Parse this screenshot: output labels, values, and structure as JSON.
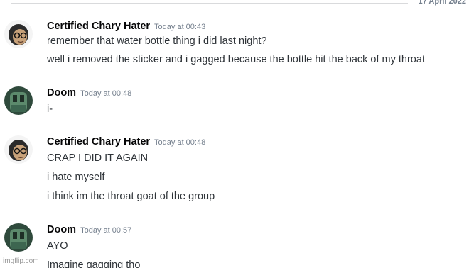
{
  "date_divider": "17 April 2022",
  "groups": [
    {
      "username": "Certified Chary Hater",
      "timestamp": "Today at 00:43",
      "avatar": "glasses-face-avatar",
      "messages": [
        "remember that water bottle thing i did last night?",
        "well i removed the sticker and i gagged because the bottle hit the back of my throat"
      ]
    },
    {
      "username": "Doom",
      "timestamp": "Today at 00:48",
      "avatar": "green-figure-avatar",
      "messages": [
        "i-"
      ]
    },
    {
      "username": "Certified Chary Hater",
      "timestamp": "Today at 00:48",
      "avatar": "glasses-face-avatar",
      "messages": [
        "CRAP I DID IT AGAIN",
        "i hate myself",
        "i think im the throat goat of the group"
      ]
    },
    {
      "username": "Doom",
      "timestamp": "Today at 00:57",
      "avatar": "green-figure-avatar",
      "messages": [
        "AYO",
        "Imagine gagging tho"
      ]
    }
  ],
  "watermark": "imgflip.com"
}
